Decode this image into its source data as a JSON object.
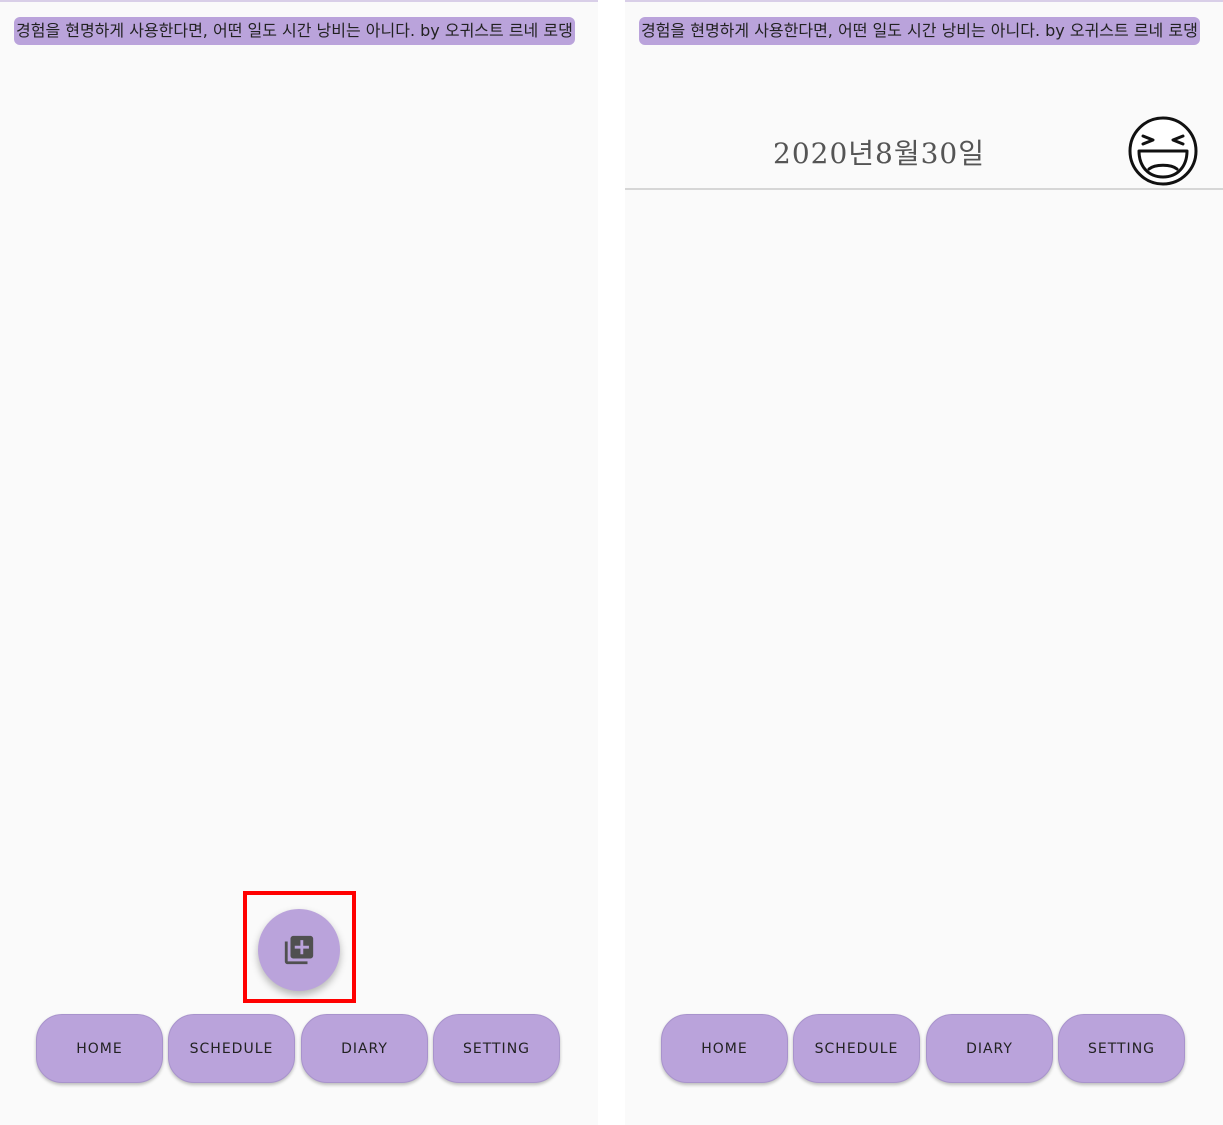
{
  "quote": "경험을 현명하게 사용한다면, 어떤 일도 시간 낭비는 아니다. by 오귀스트 르네 로댕",
  "diary": {
    "date": "2020년8월30일",
    "mood_icon": "laughing-face-icon"
  },
  "fab": {
    "icon": "add-to-library-icon"
  },
  "nav": [
    "HOME",
    "SCHEDULE",
    "DIARY",
    "SETTING"
  ],
  "colors": {
    "accent": "#baa3db",
    "background": "#fafafa",
    "highlight": "#ff0000"
  }
}
